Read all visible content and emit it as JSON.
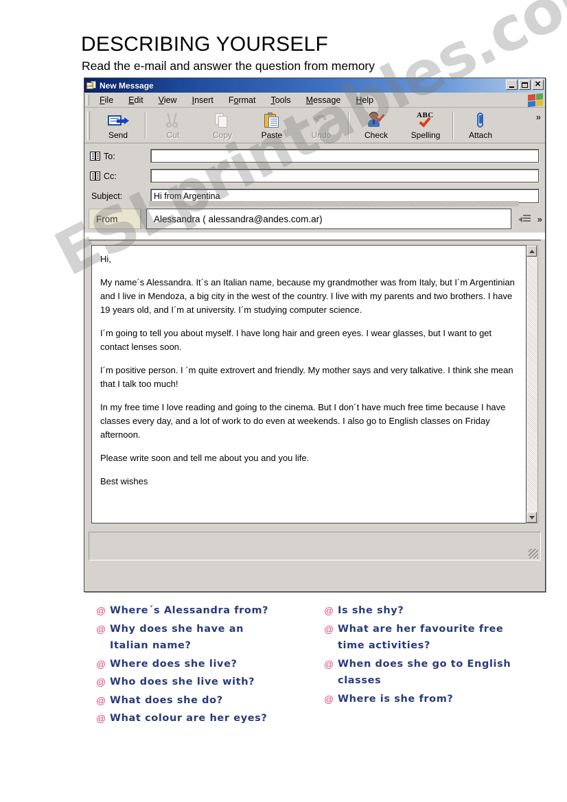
{
  "worksheet": {
    "title": "DESCRIBING YOURSELF",
    "subtitle": "Read the e-mail and answer the question from memory",
    "watermark": "ESLprintables.com"
  },
  "window": {
    "title": "New Message",
    "minimize_label": "",
    "maximize_label": "",
    "close_label": "✕"
  },
  "menu": [
    {
      "pre": "",
      "accel": "F",
      "post": "ile"
    },
    {
      "pre": "",
      "accel": "E",
      "post": "dit"
    },
    {
      "pre": "",
      "accel": "V",
      "post": "iew"
    },
    {
      "pre": "",
      "accel": "I",
      "post": "nsert"
    },
    {
      "pre": "F",
      "accel": "o",
      "post": "rmat"
    },
    {
      "pre": "",
      "accel": "T",
      "post": "ools"
    },
    {
      "pre": "",
      "accel": "M",
      "post": "essage"
    },
    {
      "pre": "",
      "accel": "H",
      "post": "elp"
    }
  ],
  "toolbar": {
    "overflow": "»",
    "buttons": [
      {
        "label": "Send",
        "icon": "send-icon",
        "disabled": false
      },
      {
        "label": "Cut",
        "icon": "scissors-icon",
        "disabled": true
      },
      {
        "label": "Copy",
        "icon": "copy-pages-icon",
        "disabled": true
      },
      {
        "label": "Paste",
        "icon": "clipboard-paste-icon",
        "disabled": false
      },
      {
        "label": "Undo",
        "icon": "undo-arrow-icon",
        "disabled": true
      },
      {
        "label": "Check",
        "icon": "check-names-icon",
        "disabled": false
      },
      {
        "label": "Spelling",
        "icon": "abc-spelling-icon",
        "disabled": false
      },
      {
        "label": "Attach",
        "icon": "paperclip-icon",
        "disabled": false
      }
    ]
  },
  "headers": {
    "to_label": "To:",
    "to_value": "",
    "cc_label": "Cc:",
    "cc_value": "",
    "subject_label": "Subject:",
    "subject_value": "Hi from Argentina",
    "from_label": "From",
    "from_value": "Alessandra ( alessandra@andes.com.ar)",
    "from_overflow": "»"
  },
  "message_body": {
    "paragraphs": [
      "Hi,",
      "My name´s Alessandra. It´s an Italian name, because my grandmother was from Italy, but I´m Argentinian and I live in Mendoza, a big city in the west of the country. I live with my parents and two brothers. I have 19 years old, and I´m at university. I´m studying computer science.",
      "I´m going to tell you about myself. I have long hair and green eyes. I wear glasses, but I want to get contact lenses soon.",
      "I´m positive person. I ´m quite extrovert and friendly. My mother says and very talkative. I think she mean that I talk too much!",
      "In my free time I love reading and going to the cinema. But I don´t have much free time because I have classes every day, and a lot of work to do even at weekends. I also go to English classes on Friday afternoon.",
      "Please write soon and tell me about you and you life.",
      "Best wishes"
    ]
  },
  "questions": {
    "bullet": "@",
    "left_column": [
      "Where´s  Alessandra from?",
      "Why does she have an\nItalian name?",
      "Where does she live?",
      "Who does she live with?",
      "What does she do?",
      "What colour are her eyes?"
    ],
    "right_column": [
      "Is she shy?",
      "What are her favourite free\ntime activities?",
      "When does she go to English\nclasses",
      "Where is she from?"
    ]
  },
  "colors": {
    "titlebar_start": "#0a246a",
    "titlebar_end": "#c3d7ef",
    "window_face": "#d6d3ce",
    "question_text": "#283a7a",
    "question_bullet": "#e34b7a",
    "from_label_bg": "#e8e4cf"
  }
}
